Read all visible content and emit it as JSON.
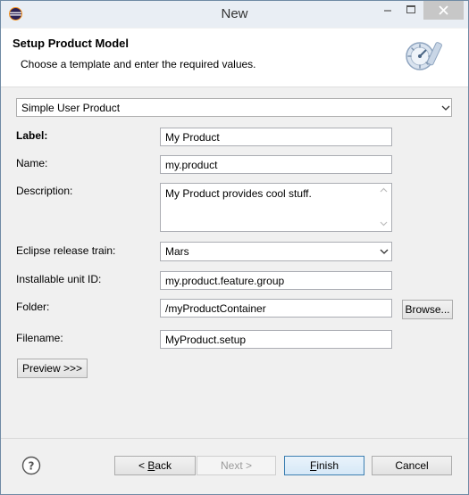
{
  "window": {
    "title": "New",
    "colors": {
      "title_bg": "#e9eef4",
      "dialog_bg": "#f0f0f0",
      "close_bg": "#c7c7c7"
    }
  },
  "header": {
    "title": "Setup Product Model",
    "description": "Choose a template and enter the required values."
  },
  "template": {
    "selected": "Simple User Product"
  },
  "form": {
    "label": {
      "label": "Label:",
      "value": "My Product"
    },
    "name": {
      "label": "Name:",
      "value": "my.product"
    },
    "description": {
      "label": "Description:",
      "value": "My Product provides cool stuff."
    },
    "release_train": {
      "label": "Eclipse release train:",
      "value": "Mars"
    },
    "iu_id": {
      "label": "Installable unit ID:",
      "value": "my.product.feature.group"
    },
    "folder": {
      "label": "Folder:",
      "value": "/myProductContainer",
      "browse": "Browse..."
    },
    "filename": {
      "label": "Filename:",
      "value": "MyProduct.setup"
    }
  },
  "preview_button": "Preview >>>",
  "footer": {
    "back": {
      "prefix": "< ",
      "key": "B",
      "rest": "ack"
    },
    "next": "Next >",
    "finish": {
      "key": "F",
      "rest": "inish"
    },
    "cancel": "Cancel"
  },
  "icons": [
    "eclipse-icon",
    "minimize-icon",
    "maximize-icon",
    "close-icon",
    "wizard-banner-icon",
    "dropdown-arrow-icon",
    "help-icon"
  ]
}
